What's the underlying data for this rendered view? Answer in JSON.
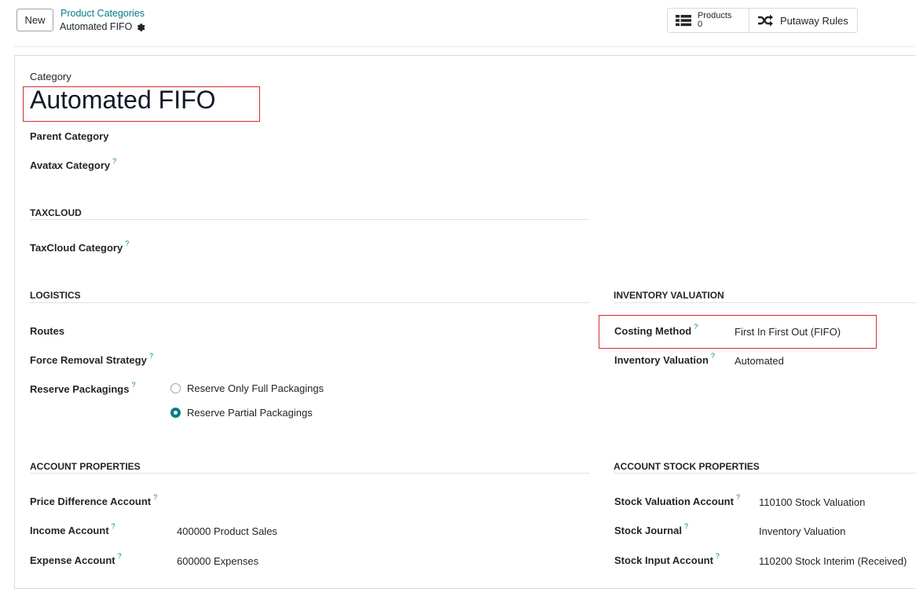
{
  "control_panel": {
    "new_label": "New",
    "breadcrumb_parent": "Product Categories",
    "breadcrumb_current": "Automated FIFO",
    "products_label": "Products",
    "products_count": "0",
    "putaway_label": "Putaway Rules"
  },
  "form": {
    "category_label": "Category",
    "category_name": "Automated FIFO",
    "parent_category_label": "Parent Category",
    "avatax_category_label": "Avatax Category",
    "help_mark": "?",
    "taxcloud": {
      "title": "TAXCLOUD",
      "category_label": "TaxCloud Category"
    },
    "logistics": {
      "title": "LOGISTICS",
      "routes_label": "Routes",
      "force_removal_label": "Force Removal Strategy",
      "reserve_packagings_label": "Reserve Packagings",
      "reserve_options": [
        "Reserve Only Full Packagings",
        "Reserve Partial Packagings"
      ],
      "reserve_selected": "Reserve Partial Packagings"
    },
    "inventory_valuation": {
      "title": "INVENTORY VALUATION",
      "costing_method_label": "Costing Method",
      "costing_method_value": "First In First Out (FIFO)",
      "inventory_valuation_label": "Inventory Valuation",
      "inventory_valuation_value": "Automated"
    },
    "account_properties": {
      "title": "ACCOUNT PROPERTIES",
      "price_difference_label": "Price Difference Account",
      "income_label": "Income Account",
      "income_value": "400000 Product Sales",
      "expense_label": "Expense Account",
      "expense_value": "600000 Expenses"
    },
    "account_stock_properties": {
      "title": "ACCOUNT STOCK PROPERTIES",
      "stock_valuation_label": "Stock Valuation Account",
      "stock_valuation_value": "110100 Stock Valuation",
      "stock_journal_label": "Stock Journal",
      "stock_journal_value": "Inventory Valuation",
      "stock_input_label": "Stock Input Account",
      "stock_input_value": "110200 Stock Interim (Received)"
    }
  },
  "colors": {
    "accent": "#017e84",
    "highlight_box": "#d62d2d"
  }
}
